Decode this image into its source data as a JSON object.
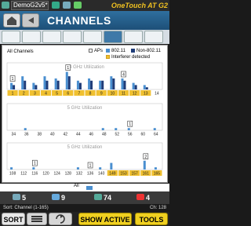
{
  "status_bar": {
    "device_name": "DemoG2v5*",
    "product_name": "OneTouch AT G2"
  },
  "header": {
    "title": "CHANNELS"
  },
  "main": {
    "title": "All Channels",
    "legend": {
      "aps": "APs",
      "ieee_80211": "802.11",
      "non_80211": "Non-802.11",
      "interferer": "Interferer detected"
    },
    "colors": {
      "bar_80211": "#4a8fd0",
      "bar_non_80211": "#1f3c78",
      "interferer": "#f0c030",
      "band_label": "#999999"
    }
  },
  "chart_data": [
    {
      "type": "bar",
      "title": "2.4 GHz Utilization",
      "categories": [
        "1",
        "2",
        "3",
        "4",
        "5",
        "6",
        "7",
        "8",
        "9",
        "10",
        "11",
        "12",
        "13",
        "14"
      ],
      "series": [
        {
          "name": "802.11",
          "values": [
            3,
            6,
            3,
            6,
            5,
            8,
            4,
            5,
            4,
            6,
            5,
            3,
            2,
            0
          ]
        },
        {
          "name": "Non-802.11",
          "values": [
            2,
            4,
            2,
            4,
            4,
            6,
            3,
            4,
            4,
            5,
            4,
            2,
            1,
            0
          ]
        }
      ],
      "ap_counts": [
        {
          "category": "1",
          "count": "1"
        },
        {
          "category": "6",
          "count": "1"
        },
        {
          "category": "11",
          "count": "4"
        }
      ],
      "interferer_channels": [
        "1",
        "2",
        "3",
        "4",
        "5",
        "6",
        "7",
        "8",
        "9",
        "10",
        "11",
        "12",
        "13"
      ]
    },
    {
      "type": "bar",
      "title": "5 GHz Utilization",
      "categories": [
        "34",
        "36",
        "38",
        "40",
        "42",
        "44",
        "46",
        "48",
        "52",
        "56",
        "60",
        "64"
      ],
      "series": [
        {
          "name": "802.11",
          "values": [
            0,
            1,
            0,
            0,
            0,
            0,
            0,
            1,
            1,
            1,
            0,
            1
          ]
        },
        {
          "name": "Non-802.11",
          "values": [
            0,
            0,
            0,
            0,
            0,
            0,
            0,
            0,
            0,
            0,
            0,
            0
          ]
        }
      ],
      "ap_counts": [
        {
          "category": "56",
          "count": "1"
        }
      ],
      "interferer_channels": []
    },
    {
      "type": "bar",
      "title": "5 GHz Utilization",
      "categories": [
        "108",
        "112",
        "116",
        "120",
        "124",
        "128",
        "132",
        "136",
        "140",
        "149",
        "153",
        "157",
        "161",
        "165"
      ],
      "series": [
        {
          "name": "802.11",
          "values": [
            1,
            0,
            1,
            0,
            0,
            0,
            1,
            0,
            1,
            3,
            0,
            0,
            4,
            1
          ]
        },
        {
          "name": "Non-802.11",
          "values": [
            0,
            0,
            0,
            0,
            0,
            0,
            0,
            0,
            0,
            0,
            0,
            0,
            0,
            0
          ]
        }
      ],
      "ap_counts": [
        {
          "category": "116",
          "count": "1"
        },
        {
          "category": "136",
          "count": "1"
        },
        {
          "category": "161",
          "count": "2"
        }
      ],
      "interferer_channels": [
        "149",
        "153",
        "157",
        "161",
        "165"
      ]
    }
  ],
  "bottom": {
    "all_label": "All",
    "counts": {
      "aps": "5",
      "clients": "9",
      "networks": "74",
      "interferers": "4"
    },
    "sort_text": "Sort: Channel (1-165)",
    "channel_count": "Ch: 128"
  },
  "toolbar": {
    "sort_label": "SORT",
    "show_active_label": "SHOW ACTIVE",
    "tools_label": "TOOLS"
  }
}
